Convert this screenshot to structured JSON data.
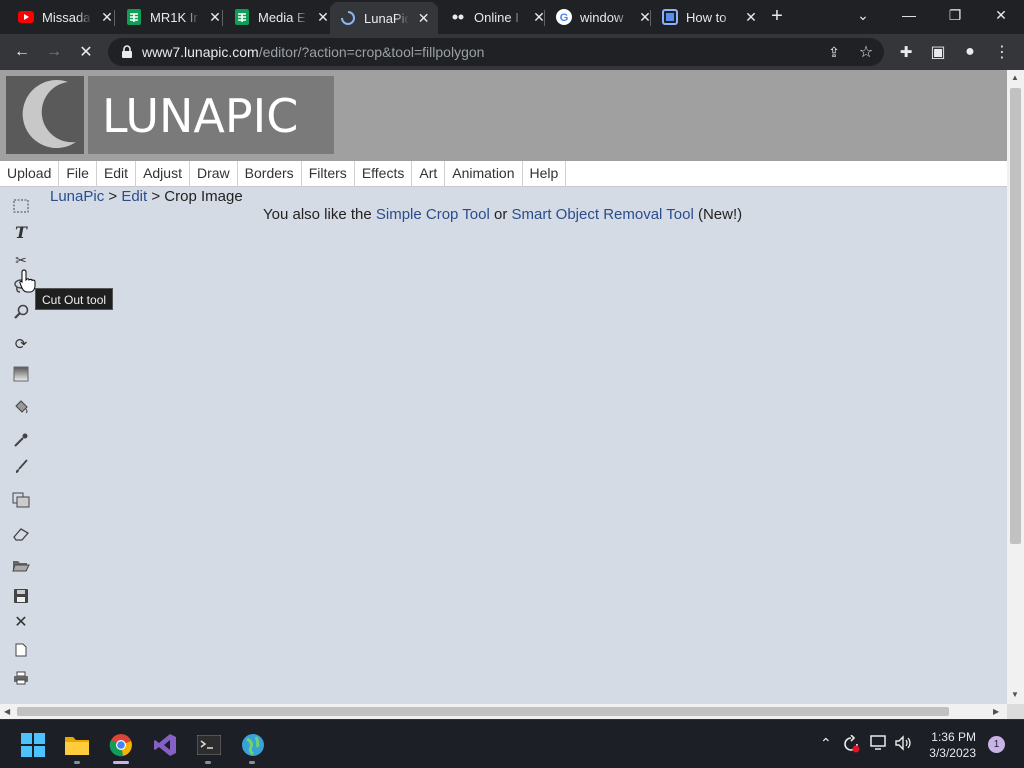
{
  "browser": {
    "tabs": [
      {
        "title": "Missada",
        "favicon": "youtube-icon",
        "active": false
      },
      {
        "title": "MR1K Ir",
        "favicon": "sheets-icon",
        "active": false
      },
      {
        "title": "Media E",
        "favicon": "sheets-icon",
        "active": false
      },
      {
        "title": "LunaPic",
        "favicon": "loading-spinner-icon",
        "active": true
      },
      {
        "title": "Online I",
        "favicon": "site-icon",
        "active": false
      },
      {
        "title": "window",
        "favicon": "google-icon",
        "active": false
      },
      {
        "title": "How to",
        "favicon": "site-icon",
        "active": false
      }
    ],
    "url_host": "www7.lunapic.com",
    "url_path": "/editor/?action=crop&tool=fillpolygon"
  },
  "page": {
    "logo_text": "LUNAPIC",
    "menu": [
      "Upload",
      "File",
      "Edit",
      "Adjust",
      "Draw",
      "Borders",
      "Filters",
      "Effects",
      "Art",
      "Animation",
      "Help"
    ],
    "breadcrumb": {
      "home": "LunaPic",
      "sep1": " > ",
      "section": "Edit",
      "sep2": " > ",
      "current": "Crop Image"
    },
    "promo": {
      "prefix": "You also like the ",
      "link1": "Simple Crop Tool",
      "middle": " or ",
      "link2": "Smart Object Removal Tool",
      "suffix": " (New!)"
    },
    "tooltip": "Cut Out tool",
    "tools": [
      "select-rect-icon",
      "text-icon",
      "scissors-icon",
      "lasso-icon",
      "zoom-icon",
      "rotate-icon",
      "gradient-icon",
      "paint-bucket-icon",
      "eyedropper-icon",
      "brush-icon",
      "resize-icon",
      "eraser-icon",
      "open-folder-icon",
      "save-icon",
      "close-icon",
      "new-doc-icon",
      "print-icon"
    ]
  },
  "taskbar": {
    "time": "1:36 PM",
    "date": "3/3/2023",
    "notification_count": "1"
  }
}
